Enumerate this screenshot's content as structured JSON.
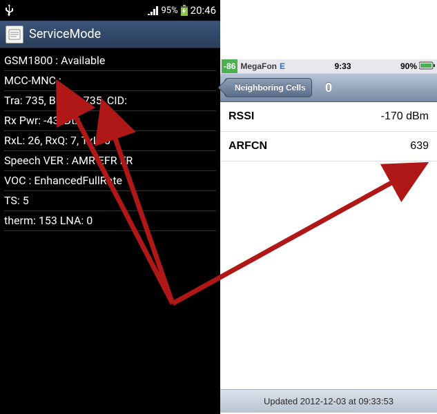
{
  "android": {
    "status": {
      "signal_percent": "95%",
      "time": "20:46"
    },
    "app_title": "ServiceMode",
    "lines": [
      "GSM1800 : Available",
      "MCC-MNC :",
      "Tra: 735, BCCH: 735, CID:",
      "Rx Pwr: -43, Dtx",
      "RxL: 26, RxQ: 7, TxL: 0",
      "Speech VER : AMR EFR FR",
      "VOC : EnhancedFullRate",
      "TS: 5",
      "therm: 153 LNA: 0"
    ]
  },
  "ios": {
    "status": {
      "signal": "-86",
      "carrier": "MegaFon",
      "network": "E",
      "time": "9:33",
      "battery_percent": "90%"
    },
    "nav": {
      "back_label": "Neighboring Cells",
      "title": "0"
    },
    "rows": [
      {
        "label": "RSSI",
        "value": "-170 dBm"
      },
      {
        "label": "ARFCN",
        "value": "639"
      }
    ],
    "footer": "Updated 2012-12-03 at 09:33:53"
  },
  "colors": {
    "arrow": "#b01818"
  }
}
